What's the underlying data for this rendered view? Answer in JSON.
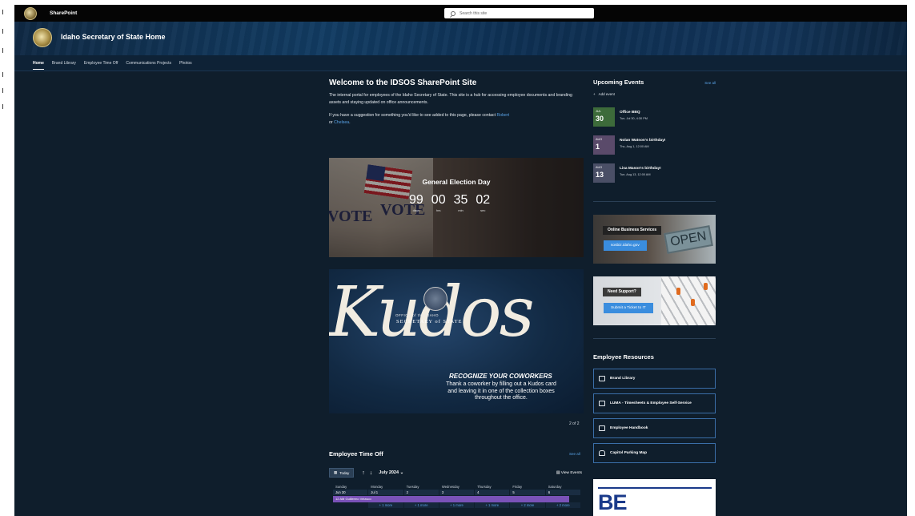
{
  "suite": {
    "app_name": "SharePoint",
    "search_placeholder": "Search this site"
  },
  "site": {
    "title": "Idaho Secretary of State Home"
  },
  "nav": [
    {
      "label": "Home",
      "active": true
    },
    {
      "label": "Brand Library",
      "active": false
    },
    {
      "label": "Employee Time Off",
      "active": false
    },
    {
      "label": "Communications Projects",
      "active": false
    },
    {
      "label": "Photos",
      "active": false
    }
  ],
  "welcome": {
    "title": "Welcome to the IDSOS SharePoint Site",
    "para1": "The internal portal for employees of the Idaho Secretary of State. This site is a hub for accessing employee documents and branding assets and staying updated on office announcements.",
    "para2_prefix": "If you have a suggestion for something you'd like to see added to this page, please contact ",
    "link1": "Robert",
    "para2_mid": " or ",
    "link2": "Chelsea",
    "para2_suffix": "."
  },
  "countdown": {
    "title": "General Election Day",
    "units": [
      {
        "value": "99",
        "label": "days"
      },
      {
        "value": "00",
        "label": "hrs"
      },
      {
        "value": "35",
        "label": "min"
      },
      {
        "value": "02",
        "label": "sec"
      }
    ],
    "image_words": [
      "VOTE",
      "VOTE"
    ]
  },
  "kudos": {
    "script_word": "Kudos",
    "office_line": "OFFICE of the IDAHO",
    "sos_line": "SECRETARY of STATE",
    "headline": "RECOGNIZE YOUR COWORKERS",
    "body": "Thank a coworker by filling out a Kudos card and leaving it in one of the collection boxes throughout the office.",
    "pager": "2 of 2"
  },
  "time_off": {
    "title": "Employee Time Off",
    "see_all": "See all",
    "today_label": "Today",
    "month_label": "July 2024",
    "view_events": "View Events",
    "weekdays": [
      "Sunday",
      "Monday",
      "Tuesday",
      "Wednesday",
      "Thursday",
      "Friday",
      "Saturday"
    ],
    "dates": [
      "Jun 30",
      "Jul 1",
      "2",
      "3",
      "4",
      "5",
      "6"
    ],
    "event_label": "12 AM  Guillermo Velasco",
    "more": [
      "",
      "+ 1 more",
      "+ 1 more",
      "+ 1 more",
      "+ 1 more",
      "+ 2 more",
      "+ 2 more"
    ]
  },
  "events": {
    "title": "Upcoming Events",
    "see_all": "See all",
    "add_label": "Add event",
    "items": [
      {
        "name": "Office BBQ",
        "when": "Tue, Jul 30, 4:30 PM",
        "month": "JUL",
        "day": "30",
        "color": "#3d6b3a"
      },
      {
        "name": "Nolan Watson's birthday!",
        "when": "Thu, Aug 1, 12:00 AM",
        "month": "AUG",
        "day": "1",
        "color": "#5a4a6a"
      },
      {
        "name": "Lisa Mason's birthday!",
        "when": "Tue, Aug 13, 12:00 AM",
        "month": "AUG",
        "day": "13",
        "color": "#4a4f66"
      }
    ]
  },
  "promos": {
    "obs": {
      "title": "Online Business Services",
      "button": "sosbiz.idaho.gov",
      "sign": "OPEN"
    },
    "support": {
      "title": "Need Support?",
      "button": "Submit a Ticket to IT"
    }
  },
  "resources": {
    "title": "Employee Resources",
    "items": [
      {
        "label": "Brand Library",
        "icon": "folder-icon"
      },
      {
        "label": "LUMA - Timesheets & Employee Self-Service",
        "icon": "calendar-icon"
      },
      {
        "label": "Employee Handbook",
        "icon": "book-icon"
      },
      {
        "label": "Capitol Parking Map",
        "icon": "car-icon"
      }
    ]
  },
  "banner": {
    "text": "BE HELPFUL"
  },
  "colors": {
    "accent": "#5aa4e8",
    "page_bg": "#0f1e2c",
    "button_blue": "#3a8dde",
    "event_purple": "#7a52b8"
  }
}
